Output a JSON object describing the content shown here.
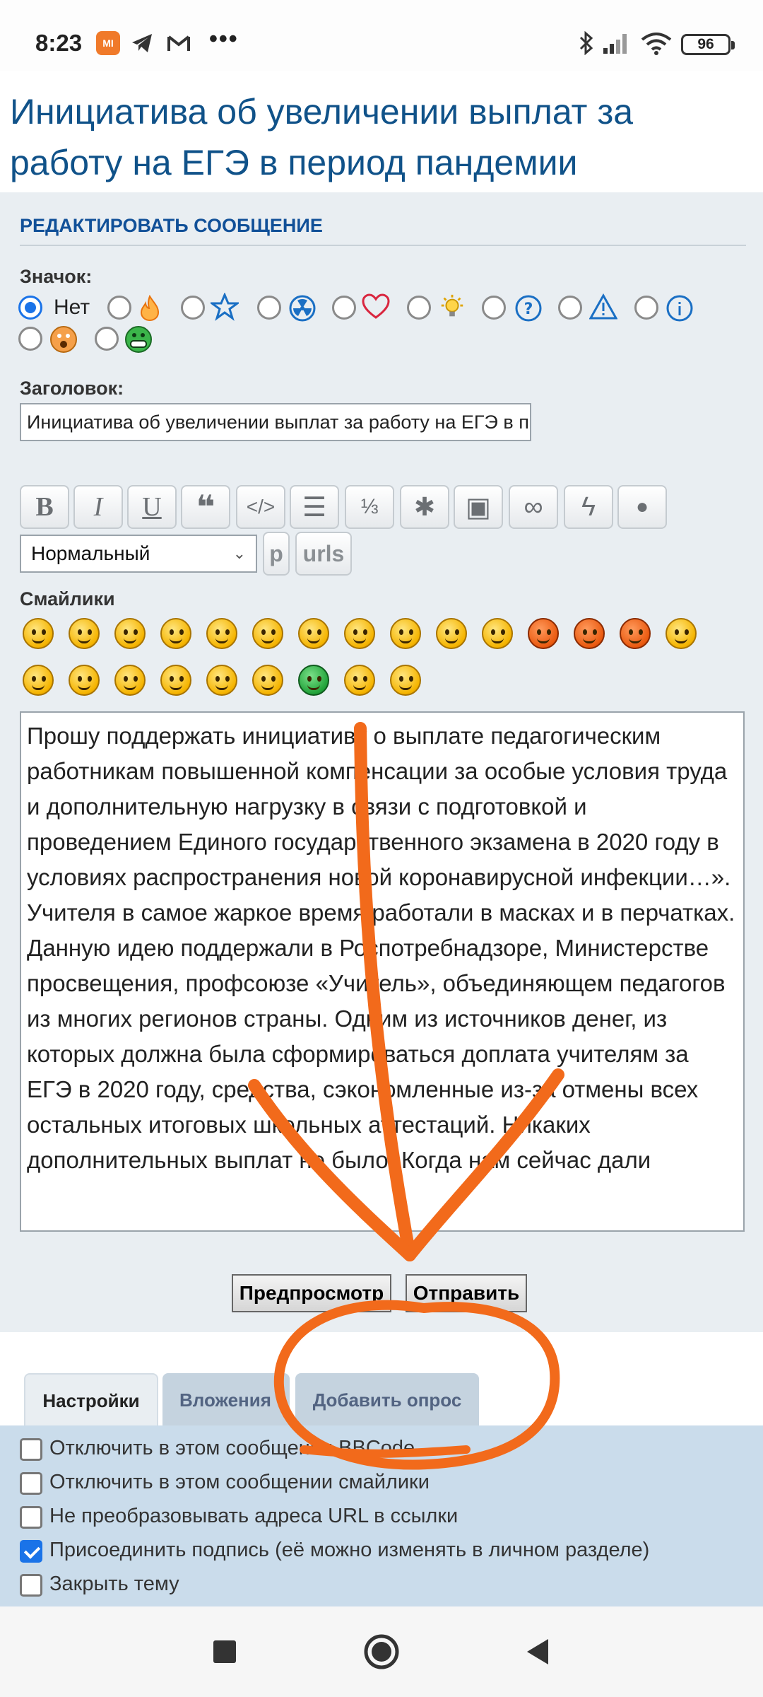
{
  "status_bar": {
    "time": "8:23",
    "mi_label": "MI",
    "battery": "96",
    "icons": [
      "mi-app-icon",
      "telegram-icon",
      "gmail-icon",
      "more-dots-icon",
      "bluetooth-icon",
      "signal-icon",
      "wifi-icon",
      "battery-icon"
    ]
  },
  "page": {
    "title": "Инициатива об увеличении выплат за работу на ЕГЭ в период пандемии"
  },
  "form": {
    "heading": "РЕДАКТИРОВАТЬ СООБЩЕНИЕ",
    "icon_label": "Значок:",
    "icon_none_label": "Нет",
    "icon_options": [
      "none",
      "fire-icon",
      "star-icon",
      "radioactive-icon",
      "heart-icon",
      "lightbulb-icon",
      "question-icon",
      "warning-icon",
      "info-icon",
      "shocked-face-icon",
      "grin-face-icon"
    ],
    "subject_label": "Заголовок:",
    "subject_value": "Инициатива об увеличении выплат за работу на ЕГЭ в период пандемии",
    "toolbar": {
      "bold": "B",
      "italic": "I",
      "underline": "U",
      "quote": "❝",
      "code": "</>",
      "list": "☰",
      "list_numbered": "⅓",
      "list_item": "✱",
      "image": "▣",
      "link": "∞",
      "flash": "ϟ",
      "color": "●"
    },
    "font_size_value": "Нормальный",
    "font_size_chevron": "⌄",
    "p_button": "p",
    "urls_button": "urls",
    "smilies_label": "Смайлики",
    "message": "Прошу поддержать инициативу о выплате педагогическим работникам повышенной компенсации за особые условия труда и дополнительную нагрузку в связи с подготовкой и проведением Единого государственного экзамена в 2020 году в условиях распространения новой коронавирусной инфекции…». Учителя в самое жаркое время работали в масках и в перчатках. Данную идею поддержали  в Роспотребнадзоре, Министерстве просвещения, профсоюзе «Учитель», объединяющем педагогов из многих регионов страны. Одним из источников денег, из которых должна была  сформироваться доплата учителям за ЕГЭ в 2020 году, средства, сэкономленные из-за отмены всех остальных итоговых школьных аттестаций. Никаких дополнительных выплат не было. Когда нам сейчас дали",
    "preview_button": "Предпросмотр",
    "submit_button": "Отправить"
  },
  "tabs": [
    {
      "label": "Настройки"
    },
    {
      "label": "Вложения"
    },
    {
      "label": "Добавить опрос"
    }
  ],
  "options": [
    {
      "label": "Отключить в этом сообщении BBCode",
      "checked": false
    },
    {
      "label": "Отключить в этом сообщении смайлики",
      "checked": false
    },
    {
      "label": "Не преобразовывать адреса URL в ссылки",
      "checked": false
    },
    {
      "label": "Присоединить подпись (её можно изменять в личном разделе)",
      "checked": true
    },
    {
      "label": "Закрыть тему",
      "checked": false
    }
  ],
  "colors": {
    "title": "#105289",
    "heading": "#115098",
    "annotation": "#f26a1b",
    "checkbox_checked": "#1a73e8"
  }
}
